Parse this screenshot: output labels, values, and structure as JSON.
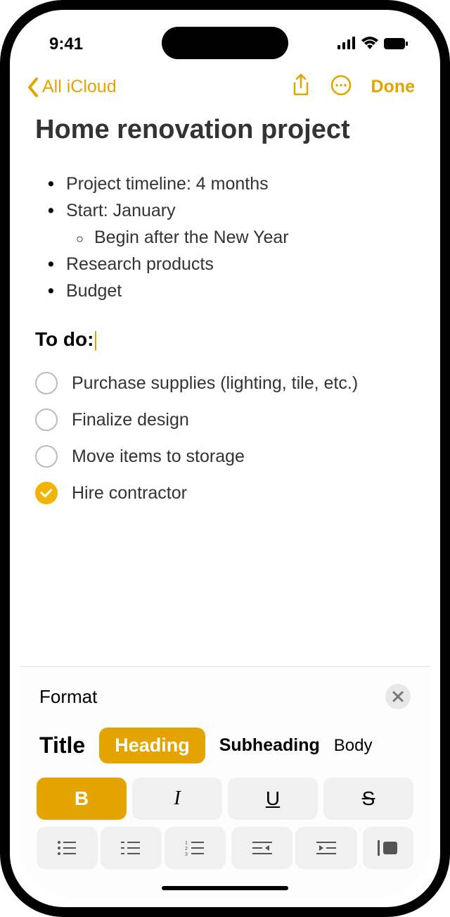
{
  "status": {
    "time": "9:41"
  },
  "nav": {
    "back_label": "All iCloud",
    "done_label": "Done"
  },
  "note": {
    "title": "Home renovation project",
    "bullets": [
      {
        "text": "Project timeline: 4 months"
      },
      {
        "text": "Start: January"
      },
      {
        "text": "Begin after the New Year",
        "sub": true
      },
      {
        "text": "Research products"
      },
      {
        "text": "Budget"
      }
    ],
    "heading": "To do:",
    "checklist": [
      {
        "text": "Purchase supplies (lighting, tile, etc.)",
        "checked": false
      },
      {
        "text": "Finalize design",
        "checked": false
      },
      {
        "text": "Move items to storage",
        "checked": false
      },
      {
        "text": "Hire contractor",
        "checked": true
      }
    ]
  },
  "format": {
    "label": "Format",
    "styles": {
      "title": "Title",
      "heading": "Heading",
      "subheading": "Subheading",
      "body": "Body"
    },
    "text_fmt": {
      "bold": "B",
      "italic": "I",
      "underline": "U",
      "strike": "S"
    }
  },
  "colors": {
    "accent": "#e4a400"
  }
}
